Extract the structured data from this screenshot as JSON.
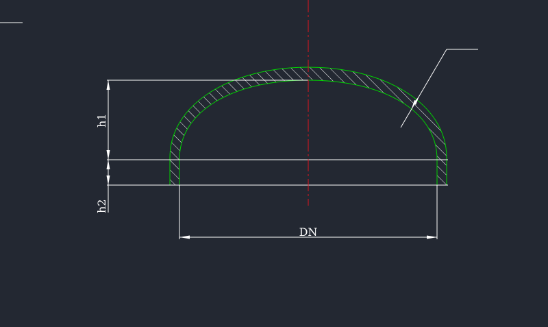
{
  "labels": {
    "h1": "h1",
    "h2": "h2",
    "dn": "DN"
  },
  "colors": {
    "background": "#232832",
    "outline": "#00d400",
    "centerline": "#e0141e",
    "dimension": "#ffffff"
  }
}
